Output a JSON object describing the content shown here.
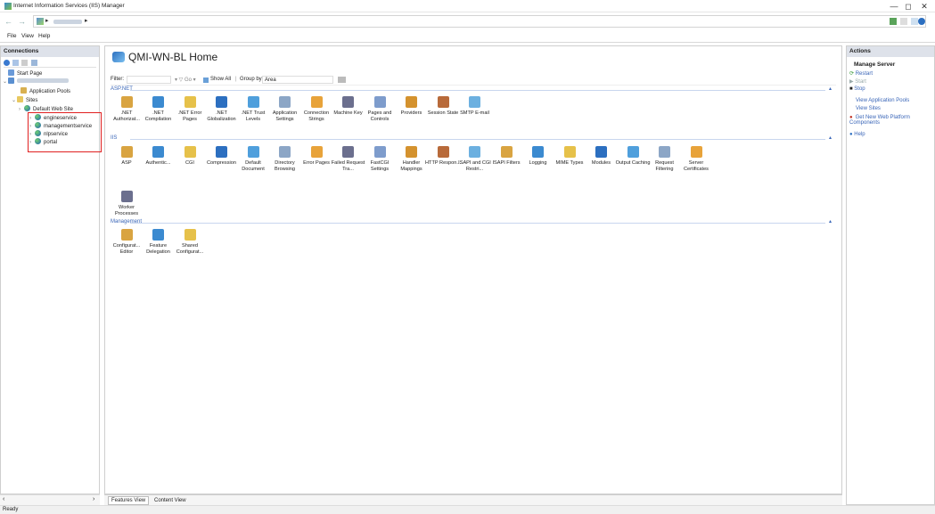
{
  "window": {
    "title": "Internet Information Services (IIS) Manager",
    "min": "—",
    "max": "◻",
    "close": "✕"
  },
  "address": {
    "back": "←",
    "forward": "→",
    "sep": "▸"
  },
  "menu": [
    "File",
    "View",
    "Help"
  ],
  "connections": {
    "title": "Connections",
    "start_page": "Start Page",
    "app_pools": "Application Pools",
    "sites": "Sites",
    "default_site": "Default Web Site",
    "site_items": [
      "engineservice",
      "managementservice",
      "nlpservice",
      "portal"
    ]
  },
  "center": {
    "title": "QMI-WN-BL Home",
    "filter_label": "Filter:",
    "go": "▾ ▽ Go ▾",
    "show_all": "Show All",
    "group_by": "Group by:",
    "group_value": "Area",
    "sections": {
      "aspnet": "ASP.NET",
      "iis": "IIS",
      "mgmt": "Management"
    },
    "aspnet": [
      ".NET Authorizat...",
      ".NET Compilation",
      ".NET Error Pages",
      ".NET Globalization",
      ".NET Trust Levels",
      "Application Settings",
      "Connection Strings",
      "Machine Key",
      "Pages and Controls",
      "Providers",
      "Session State",
      "SMTP E-mail"
    ],
    "iis": [
      "ASP",
      "Authentic...",
      "CGI",
      "Compression",
      "Default Document",
      "Directory Browsing",
      "Error Pages",
      "Failed Request Tra...",
      "FastCGI Settings",
      "Handler Mappings",
      "HTTP Respon...",
      "ISAPI and CGI Restri...",
      "ISAPI Filters",
      "Logging",
      "MIME Types",
      "Modules",
      "Output Caching",
      "Request Filtering",
      "Server Certificates",
      "Worker Processes"
    ],
    "mgmt": [
      "Configurat... Editor",
      "Feature Delegation",
      "Shared Configurat..."
    ],
    "tabs": {
      "features": "Features View",
      "content": "Content View"
    }
  },
  "actions": {
    "title": "Actions",
    "heading": "Manage Server",
    "restart": "Restart",
    "start": "Start",
    "stop": "Stop",
    "view_pools": "View Application Pools",
    "view_sites": "View Sites",
    "get_new": "Get New Web Platform Components",
    "help": "Help"
  },
  "status": "Ready",
  "colors": {
    "accent": "#3a66b8",
    "highlight": "#e02020"
  }
}
